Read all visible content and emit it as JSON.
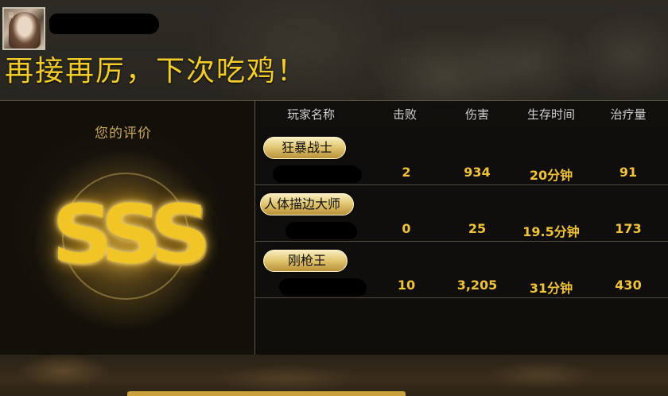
{
  "headline": "再接再厉，下次吃鸡！",
  "rating": {
    "title": "您的评价",
    "grade": "SSS"
  },
  "columns": [
    "玩家名称",
    "击败",
    "伤害",
    "生存时间",
    "治疗量"
  ],
  "rows": [
    {
      "title": "狂暴战士",
      "kills": "2",
      "damage": "934",
      "survival": "20分钟",
      "healing": "91"
    },
    {
      "title": "人体描边大师",
      "kills": "0",
      "damage": "25",
      "survival": "19.5分钟",
      "healing": "173"
    },
    {
      "title": "刚枪王",
      "kills": "10",
      "damage": "3,205",
      "survival": "31分钟",
      "healing": "430"
    }
  ],
  "colors": {
    "headline": "#f3cc2c",
    "stat_value": "#f0c23a",
    "badge": "#e4c974"
  },
  "icons": {
    "avatar_badge": "crown-icon"
  }
}
